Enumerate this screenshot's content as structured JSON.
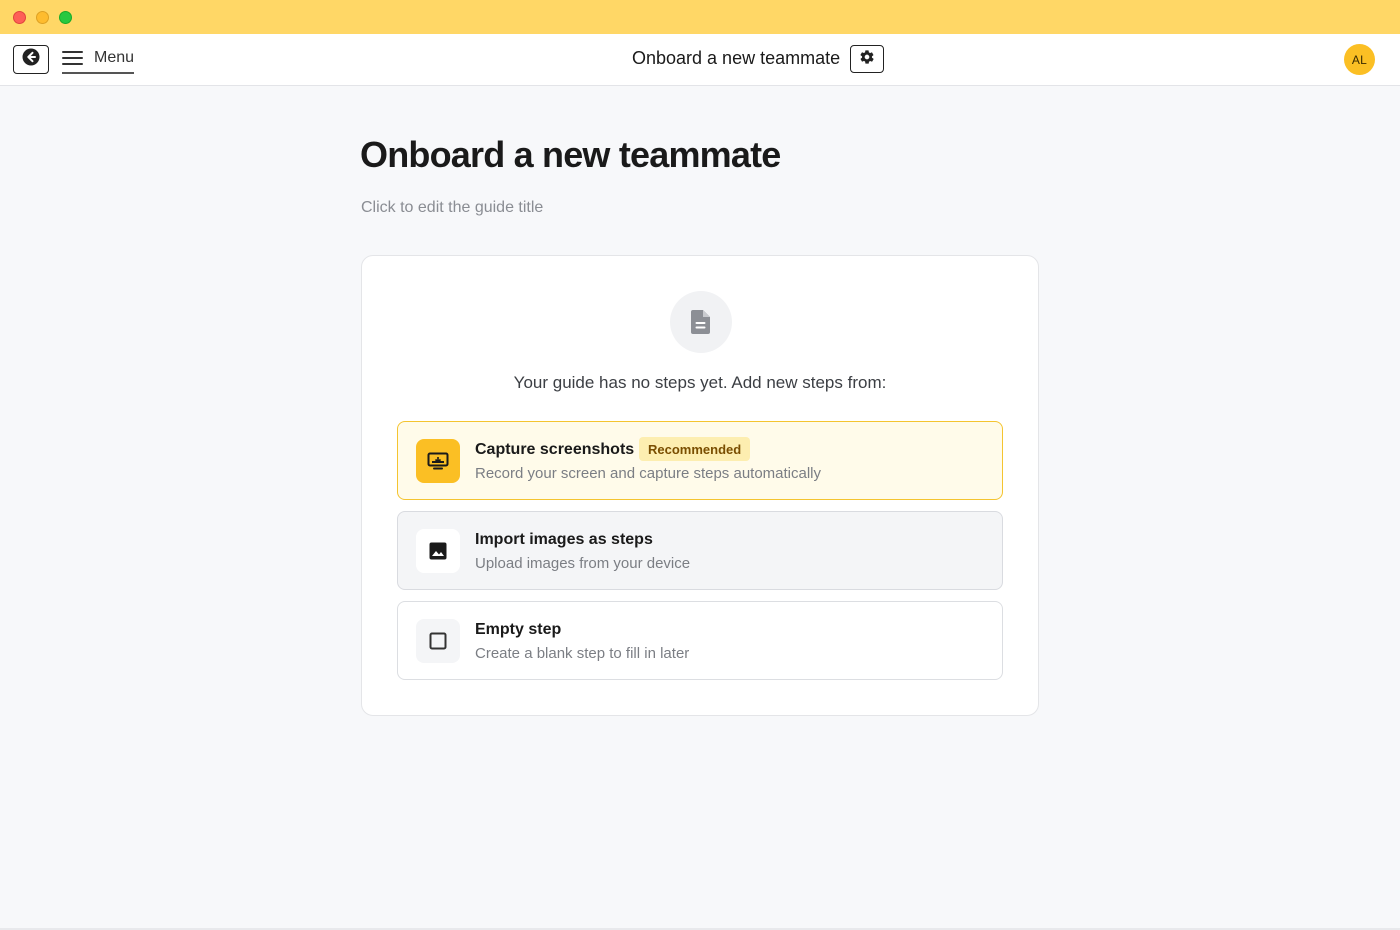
{
  "window": {
    "traffic_lights": [
      "close",
      "minimize",
      "zoom"
    ],
    "titlebar_color": "#ffd766"
  },
  "topbar": {
    "back_icon": "arrow-left-circle-icon",
    "menu_label": "Menu",
    "title": "Onboard a new teammate",
    "settings_icon": "gear-icon",
    "avatar_initials": "AL",
    "avatar_color": "#fbbf24"
  },
  "main": {
    "title": "Onboard a new teammate",
    "subtitle": "Click to edit the guide title",
    "empty_icon": "document-icon",
    "empty_message": "Your guide has no steps yet. Add new steps from:",
    "options": [
      {
        "title": "Capture screenshots",
        "badge": "Recommended",
        "description": "Record your screen and capture steps automatically",
        "icon": "screen-capture-icon",
        "accent": "#fbbf24"
      },
      {
        "title": "Import images as steps",
        "description": "Upload images from your device",
        "icon": "image-icon"
      },
      {
        "title": "Empty step",
        "description": "Create a blank step to fill in later",
        "icon": "square-icon"
      }
    ]
  }
}
